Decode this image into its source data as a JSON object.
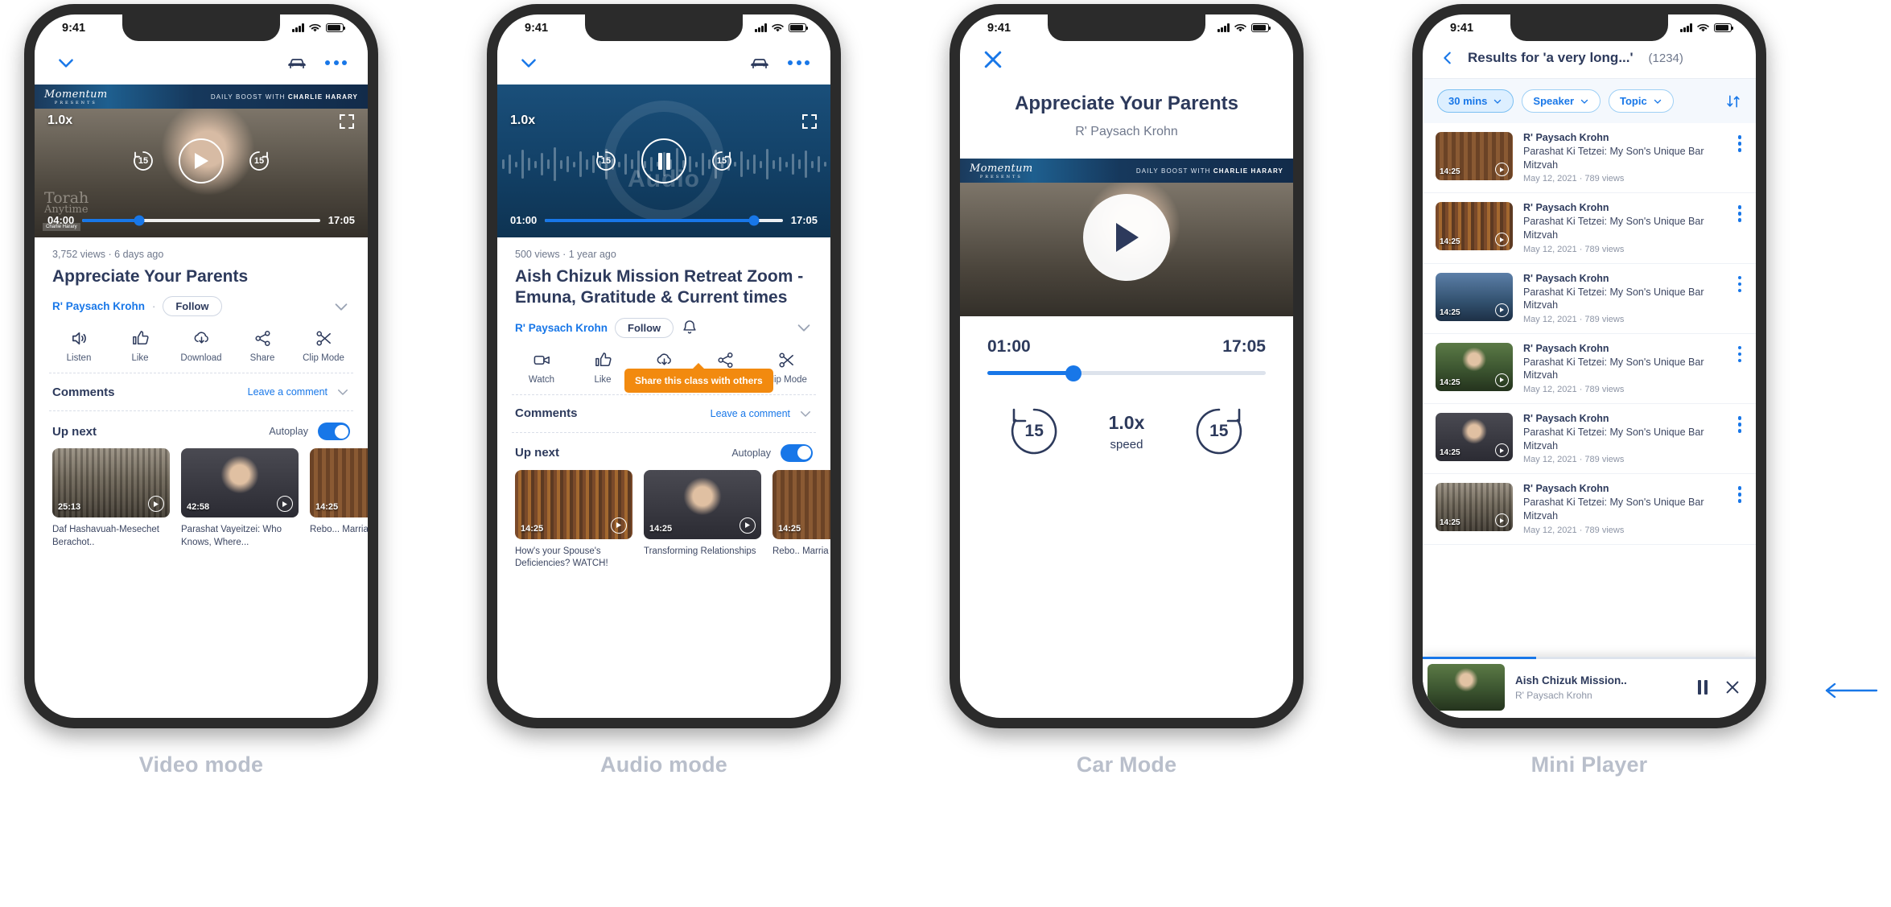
{
  "phones": [
    {
      "id": "video-mode",
      "mode_label": "Video mode",
      "status": {
        "time": "9:41"
      },
      "topnav": {
        "collapse_icon": "chevron-down-icon",
        "car_icon": "car-icon",
        "more_icon": "more-dots-icon"
      },
      "player": {
        "type": "video",
        "speed": "1.0x",
        "current_time": "04:00",
        "duration": "17:05",
        "progress_pct": 24,
        "skip_back": "15",
        "skip_fwd": "15",
        "state": "play",
        "banner_brand": "Momentum",
        "banner_brand_sub": "PRESENTS",
        "banner_right": "DAILY BOOST WITH ",
        "banner_right_bold": "CHARLIE HARARY",
        "watermark": "Torah",
        "watermark_sub": "Anytime",
        "corner_tag": "Charlie Harary"
      },
      "meta": {
        "views": "3,752 views",
        "sep": "·",
        "age": "6 days ago",
        "title": "Appreciate Your Parents",
        "channel": "R' Paysach Krohn",
        "follow": "Follow"
      },
      "actions": [
        {
          "icon": "speaker-icon",
          "label": "Listen"
        },
        {
          "icon": "thumbs-up-icon",
          "label": "Like"
        },
        {
          "icon": "download-cloud-icon",
          "label": "Download"
        },
        {
          "icon": "share-icon",
          "label": "Share"
        },
        {
          "icon": "scissors-icon",
          "label": "Clip Mode"
        }
      ],
      "comments": {
        "title": "Comments",
        "link": "Leave a comment"
      },
      "upnext": {
        "title": "Up next",
        "autoplay_label": "Autoplay",
        "autoplay_on": true
      },
      "cards": [
        {
          "duration": "25:13",
          "caption": "Daf Hashavuah-Mesechet Berachot.."
        },
        {
          "duration": "42:58",
          "caption": "Parashat Vayeitzei: Who Knows, Where..."
        },
        {
          "duration": "14:25",
          "caption": "Rebo... Marria"
        }
      ]
    },
    {
      "id": "audio-mode",
      "mode_label": "Audio mode",
      "status": {
        "time": "9:41"
      },
      "topnav": {
        "collapse_icon": "chevron-down-icon",
        "car_icon": "car-icon",
        "more_icon": "more-dots-icon"
      },
      "player": {
        "type": "audio",
        "speed": "1.0x",
        "current_time": "01:00",
        "duration": "17:05",
        "progress_pct": 88,
        "skip_back": "15",
        "skip_fwd": "15",
        "state": "pause",
        "artwork_word": "Audio"
      },
      "meta": {
        "views": "500 views",
        "sep": "·",
        "age": "1 year ago",
        "title": "Aish Chizuk Mission Retreat Zoom - Emuna, Gratitude & Current times",
        "channel": "R' Paysach Krohn",
        "follow": "Follow",
        "bell_icon": "bell-icon"
      },
      "actions": [
        {
          "icon": "video-camera-icon",
          "label": "Watch"
        },
        {
          "icon": "thumbs-up-icon",
          "label": "Like"
        },
        {
          "icon": "download-cloud-icon",
          "label": "Download"
        },
        {
          "icon": "share-icon",
          "label": "Share"
        },
        {
          "icon": "scissors-icon",
          "label": "Clip Mode"
        }
      ],
      "tooltip": "Share this class with others",
      "comments": {
        "title": "Comments",
        "link": "Leave a comment"
      },
      "upnext": {
        "title": "Up next",
        "autoplay_label": "Autoplay",
        "autoplay_on": true
      },
      "cards": [
        {
          "duration": "14:25",
          "caption": "How's your Spouse's Deficiencies? WATCH!"
        },
        {
          "duration": "14:25",
          "caption": "Transforming Relationships"
        },
        {
          "duration": "14:25",
          "caption": "Rebo.. Marria"
        }
      ]
    },
    {
      "id": "car-mode",
      "mode_label": "Car Mode",
      "status": {
        "time": "9:41"
      },
      "close_icon": "close-icon",
      "title": "Appreciate Your Parents",
      "speaker": "R' Paysach Krohn",
      "player": {
        "current_time": "01:00",
        "duration": "17:05",
        "progress_pct": 31,
        "skip_back": "15",
        "skip_fwd": "15",
        "speed_value": "1.0x",
        "speed_label": "speed",
        "banner_brand": "Momentum",
        "banner_brand_sub": "PRESENTS",
        "banner_right": "DAILY BOOST WITH ",
        "banner_right_bold": "CHARLIE HARARY"
      }
    },
    {
      "id": "mini-player",
      "mode_label": "Mini Player",
      "status": {
        "time": "9:41"
      },
      "header": {
        "back_icon": "chevron-left-icon",
        "title": "Results for 'a very long...'",
        "count": "(1234)"
      },
      "filters": [
        {
          "label": "30 mins",
          "selected": true,
          "chevron": "chevron-down-icon"
        },
        {
          "label": "Speaker",
          "selected": false,
          "chevron": "chevron-down-icon"
        },
        {
          "label": "Topic",
          "selected": false,
          "chevron": "chevron-down-icon"
        }
      ],
      "sort_icon": "sort-icon",
      "results": [
        {
          "duration": "14:25",
          "speaker": "R' Paysach Krohn",
          "title": "Parashat Ki Tetzei: My Son's Unique Bar Mitzvah",
          "sub": "May 12, 2021 · 789 views",
          "thumb": "ph-shul"
        },
        {
          "duration": "14:25",
          "speaker": "R' Paysach Krohn",
          "title": "Parashat Ki Tetzei: My Son's Unique Bar Mitzvah",
          "sub": "May 12, 2021 · 789 views",
          "thumb": "ph-books"
        },
        {
          "duration": "14:25",
          "speaker": "R' Paysach Krohn",
          "title": "Parashat Ki Tetzei: My Son's Unique Bar Mitzvah",
          "sub": "May 12, 2021 · 789 views",
          "thumb": "ph-blue"
        },
        {
          "duration": "14:25",
          "speaker": "R' Paysach Krohn",
          "title": "Parashat Ki Tetzei: My Son's Unique Bar Mitzvah",
          "sub": "May 12, 2021 · 789 views",
          "thumb": "ph-green"
        },
        {
          "duration": "14:25",
          "speaker": "R' Paysach Krohn",
          "title": "Parashat Ki Tetzei: My Son's Unique Bar Mitzvah",
          "sub": "May 12, 2021 · 789 views",
          "thumb": "ph-suit"
        },
        {
          "duration": "14:25",
          "speaker": "R' Paysach Krohn",
          "title": "Parashat Ki Tetzei: My Son's Unique Bar Mitzvah",
          "sub": "May 12, 2021 · 789 views",
          "thumb": "ph-room"
        }
      ],
      "mini": {
        "title": "Aish Chizuk Mission..",
        "subtitle": "R' Paysach Krohn",
        "pause_icon": "pause-icon",
        "close_icon": "close-icon",
        "progress_pct": 34
      }
    }
  ],
  "colors": {
    "accent_blue": "#1877e8",
    "navy": "#2d3a5c",
    "tooltip_orange": "#f28a0f",
    "label_grey": "#b9bfcb"
  }
}
